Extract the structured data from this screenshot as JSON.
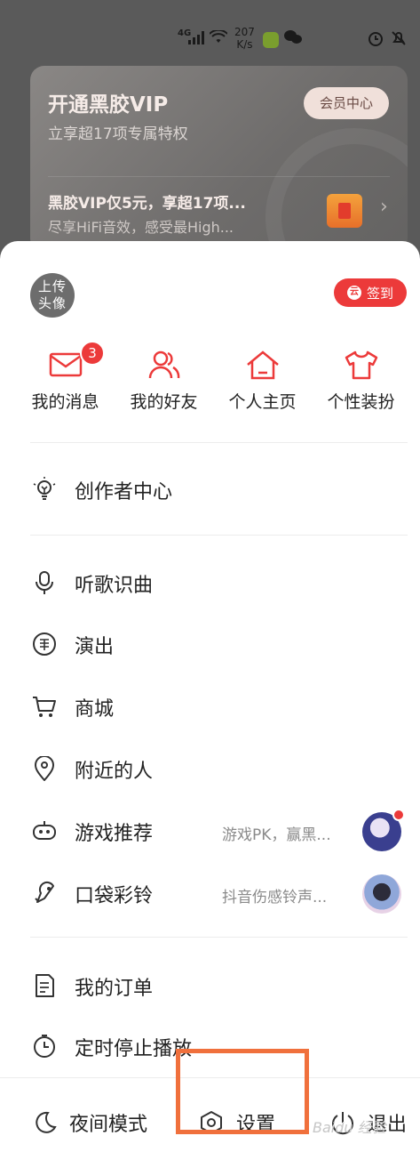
{
  "status_bar": {
    "network": "4G",
    "speed_value": "207",
    "speed_unit": "K/s",
    "icons": [
      "signal-icon",
      "wifi-icon",
      "app-icon",
      "wechat-icon",
      "alarm-icon",
      "mute-icon"
    ]
  },
  "vip": {
    "title": "开通黑胶VIP",
    "subtitle": "立享超17项专属特权",
    "center_button": "会员中心",
    "promo_title": "黑胶VIP仅5元，享超17项...",
    "promo_subtitle": "尽享HiFi音效，感受最High..."
  },
  "profile": {
    "avatar_label_line1": "上传",
    "avatar_label_line2": "头像",
    "signin_label": "签到",
    "signin_coin": "云"
  },
  "quick_actions": [
    {
      "label": "我的消息",
      "badge": "3"
    },
    {
      "label": "我的好友"
    },
    {
      "label": "个人主页"
    },
    {
      "label": "个性装扮"
    }
  ],
  "menu": {
    "creator": "创作者中心",
    "items": [
      {
        "label": "听歌识曲"
      },
      {
        "label": "演出"
      },
      {
        "label": "商城"
      },
      {
        "label": "附近的人"
      },
      {
        "label": "游戏推荐",
        "extra": "游戏PK，赢黑..."
      },
      {
        "label": "口袋彩铃",
        "extra": "抖音伤感铃声..."
      }
    ],
    "orders": "我的订单",
    "timer": "定时停止播放"
  },
  "bottom": {
    "night_mode": "夜间模式",
    "settings": "设置",
    "logout": "退出",
    "watermark": "Baidu 经验"
  },
  "colors": {
    "accent_red": "#ec3a3a",
    "highlight_orange": "#f0703c"
  }
}
